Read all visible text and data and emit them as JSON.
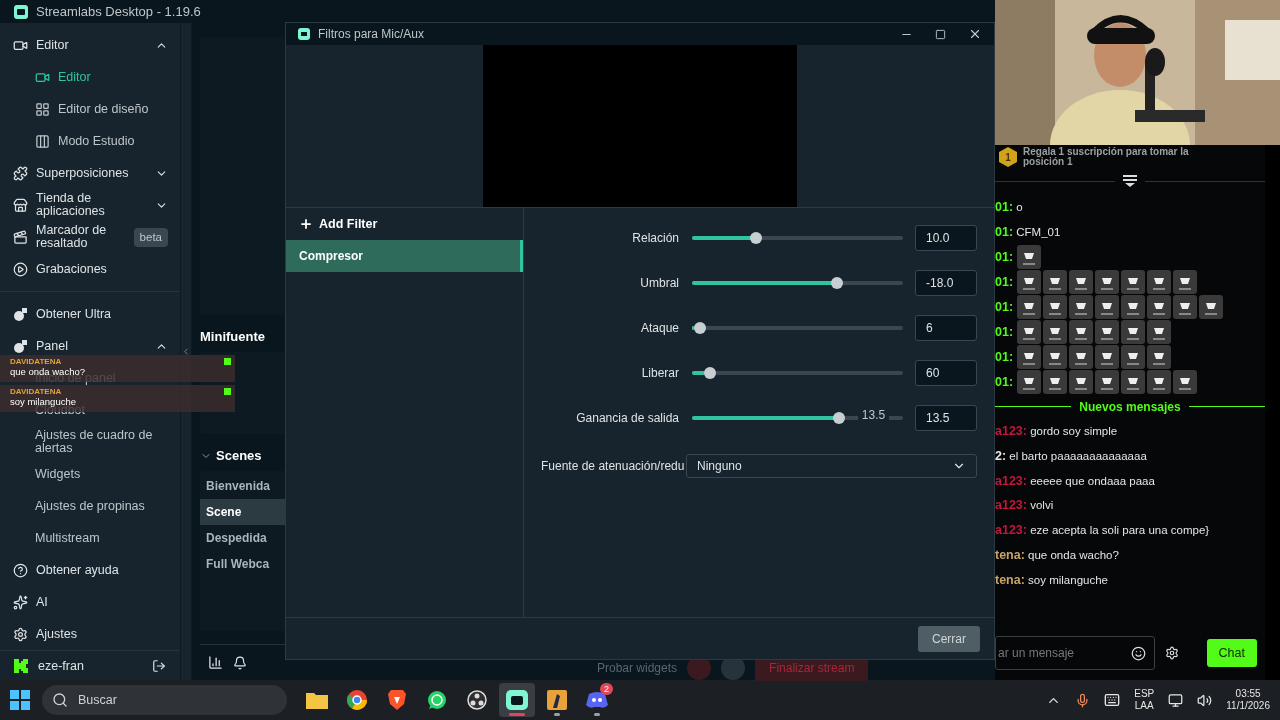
{
  "app": {
    "title": "Streamlabs Desktop - 1.19.6"
  },
  "sidebar": {
    "items": [
      {
        "kind": "section",
        "label": "Editor",
        "expanded": true,
        "children": [
          {
            "label": "Editor",
            "selected": true
          },
          {
            "label": "Editor de diseño",
            "selected": false
          },
          {
            "label": "Modo Estudio",
            "selected": false
          }
        ]
      },
      {
        "kind": "section",
        "label": "Superposiciones",
        "expanded": false
      },
      {
        "kind": "section",
        "label": "Tienda de aplicaciones",
        "expanded": false
      },
      {
        "kind": "link",
        "label": "Marcador de resaltado",
        "badge": "beta"
      },
      {
        "kind": "link",
        "label": "Grabaciones"
      },
      {
        "kind": "divider"
      },
      {
        "kind": "link",
        "label": "Obtener Ultra"
      },
      {
        "kind": "section",
        "label": "Panel",
        "expanded": true,
        "children": [
          {
            "label": "Inicio de panel",
            "selected": false
          },
          {
            "label": "Cloudbot",
            "selected": false
          },
          {
            "label": "Ajustes de cuadro de alertas",
            "selected": false
          },
          {
            "label": "Widgets",
            "selected": false
          },
          {
            "label": "Ajustes de propinas",
            "selected": false
          },
          {
            "label": "Multistream",
            "selected": false
          }
        ]
      },
      {
        "kind": "link",
        "label": "Obtener ayuda"
      },
      {
        "kind": "link",
        "label": "AI"
      },
      {
        "kind": "link",
        "label": "Ajustes"
      }
    ],
    "user": "eze-fran"
  },
  "editor": {
    "minifuente": "Minifuente",
    "scenes_title": "Scenes",
    "scenes": [
      {
        "label": "Bienvenida",
        "selected": false
      },
      {
        "label": "Scene",
        "selected": true
      },
      {
        "label": "Despedida",
        "selected": false
      },
      {
        "label": "Full Webca",
        "selected": false
      }
    ],
    "test_widgets": "Probar widgets",
    "end_stream": "Finalizar stream"
  },
  "overlay_messages": [
    {
      "user": "DAVIDATENA",
      "text": "que onda wacho?"
    },
    {
      "user": "DAVIDATENA",
      "text": "soy milanguche"
    }
  ],
  "dialog": {
    "title": "Filtros para Mic/Aux",
    "add_filter": "Add Filter",
    "filters": [
      {
        "label": "Compresor",
        "selected": true
      }
    ],
    "sliders": [
      {
        "label": "Relación",
        "level": 0.29,
        "value": "10.0"
      },
      {
        "label": "Umbral",
        "level": 0.7,
        "value": "-18.0"
      },
      {
        "label": "Ataque",
        "level": 0.01,
        "value": "6"
      },
      {
        "label": "Liberar",
        "level": 0.06,
        "value": "60"
      },
      {
        "label": "Ganancia de salida",
        "level": 0.71,
        "value": "13.5",
        "tooltip": "13.5"
      }
    ],
    "select": {
      "label": "Fuente de atenuación/redu",
      "value": "Ninguno"
    },
    "close": "Cerrar"
  },
  "chat": {
    "leader": {
      "rank": "1",
      "text": "Regala 1 suscripción para tomar la posición 1"
    },
    "messages": [
      {
        "user": "01:",
        "color": "#53fc18",
        "text": "o"
      },
      {
        "user": "01:",
        "color": "#53fc18",
        "text": "CFM_01"
      },
      {
        "user": "01:",
        "color": "#53fc18",
        "emotes": [
          {
            "kind": "cup"
          }
        ]
      },
      {
        "user": "01:",
        "color": "#53fc18",
        "emotes": [
          {
            "kind": "cup"
          },
          {
            "kind": "cup"
          },
          {
            "kind": "cup"
          },
          {
            "kind": "cup"
          },
          {
            "kind": "cup"
          },
          {
            "kind": "cup"
          },
          {
            "kind": "cup"
          }
        ]
      },
      {
        "user": "01:",
        "color": "#53fc18",
        "emotes": [
          {
            "kind": "cup"
          },
          {
            "kind": "cup"
          },
          {
            "kind": "cup"
          },
          {
            "kind": "cup"
          },
          {
            "kind": "cup"
          },
          {
            "kind": "cup"
          },
          {
            "kind": "cup"
          },
          {
            "kind": "cup"
          }
        ]
      },
      {
        "user": "01:",
        "color": "#53fc18",
        "emotes": [
          {
            "kind": "cup"
          },
          {
            "kind": "cup"
          },
          {
            "kind": "cup"
          },
          {
            "kind": "cup"
          },
          {
            "kind": "cup"
          },
          {
            "kind": "cup"
          }
        ]
      },
      {
        "user": "01:",
        "color": "#53fc18",
        "emotes": [
          {
            "kind": "cup"
          },
          {
            "kind": "cup"
          },
          {
            "kind": "cup"
          },
          {
            "kind": "cup"
          },
          {
            "kind": "cup"
          },
          {
            "kind": "cup"
          }
        ]
      },
      {
        "user": "01:",
        "color": "#53fc18",
        "emotes": [
          {
            "kind": "cup"
          },
          {
            "kind": "cup"
          },
          {
            "kind": "cup"
          },
          {
            "kind": "cup"
          },
          {
            "kind": "cup"
          },
          {
            "kind": "cup"
          },
          {
            "kind": "cup"
          }
        ]
      },
      {
        "kind": "divider",
        "text": "Nuevos mensajes"
      },
      {
        "user": "a123:",
        "color": "#c4173d",
        "text": "gordo soy simple"
      },
      {
        "user": "2:",
        "color": "#e6e6e6",
        "text": "el barto paaaaaaaaaaaaaa"
      },
      {
        "user": "a123:",
        "color": "#c4173d",
        "text": "eeeee que ondaaa paaa"
      },
      {
        "user": "a123:",
        "color": "#c4173d",
        "text": "volvi"
      },
      {
        "user": "a123:",
        "color": "#c4173d",
        "text": "eze acepta la soli para una compe}"
      },
      {
        "user": "tena:",
        "color": "#c9a36a",
        "text": "que onda wacho?"
      },
      {
        "user": "tena:",
        "color": "#c9a36a",
        "text": "soy milanguche"
      }
    ],
    "input_placeholder": "ar un mensaje",
    "send": "Chat"
  },
  "taskbar": {
    "search_placeholder": "Buscar",
    "apps": [
      {
        "kind": "folder",
        "selected": false,
        "running": false
      },
      {
        "kind": "chrome",
        "selected": false,
        "running": false
      },
      {
        "kind": "brave",
        "selected": false,
        "running": false
      },
      {
        "kind": "whatsapp",
        "selected": false,
        "running": false
      },
      {
        "kind": "obs",
        "selected": false,
        "running": false
      },
      {
        "kind": "streamlabs",
        "selected": true,
        "running": true
      },
      {
        "kind": "game",
        "selected": false,
        "running": true
      },
      {
        "kind": "discord",
        "selected": false,
        "running": true,
        "badge": "2"
      }
    ],
    "lang": "ESP",
    "layout": "LAA",
    "time": "03:55",
    "date": "11/1/2026"
  }
}
